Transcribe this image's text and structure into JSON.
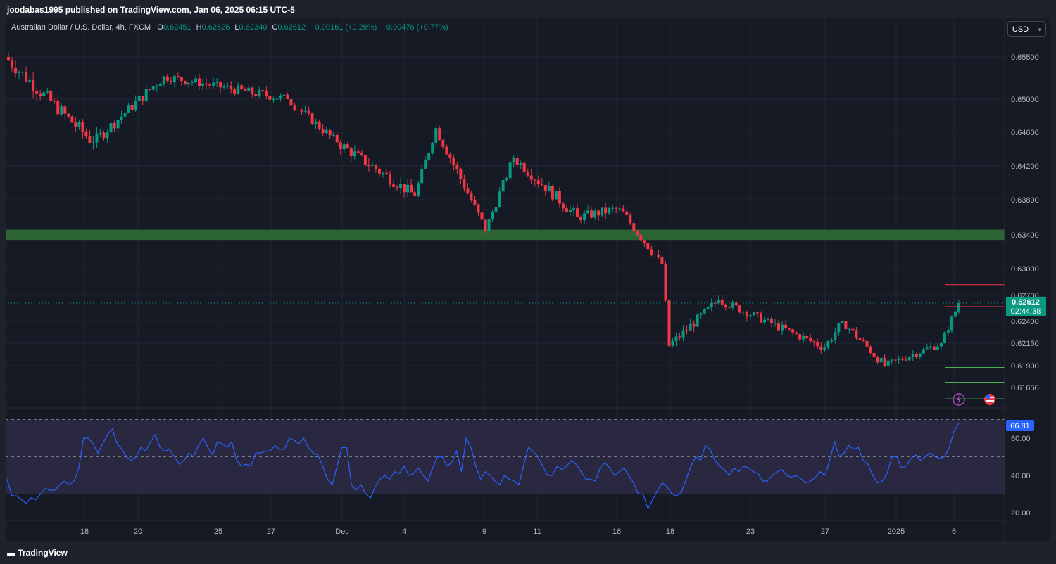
{
  "header": {
    "published_line": "joodabas1995 published on TradingView.com, Jan 06, 2025 06:15 UTC-5"
  },
  "legend": {
    "symbol": "Australian Dollar / U.S. Dollar, 4h, FXCM",
    "o_label": "O",
    "o_value": "0.62451",
    "h_label": "H",
    "h_value": "0.62626",
    "l_label": "L",
    "l_value": "0.62340",
    "c_label": "C",
    "c_value": "0.62612",
    "change": "+0.00161 (+0.26%)",
    "change2": "+0.00476 (+0.77%)"
  },
  "currency_button": "USD",
  "footer": {
    "brand": "TradingView"
  },
  "colors": {
    "up": "#089981",
    "down": "#f23645",
    "zone": "#2e6b34",
    "rsi_line": "#2962ff",
    "rsi_band": "#2a2740",
    "background": "#161a25"
  },
  "chart_data": [
    {
      "type": "candlestick",
      "price_ticks": [
        "0.65500",
        "0.65000",
        "0.64600",
        "0.64200",
        "0.63800",
        "0.63400",
        "0.63000",
        "0.62700",
        "0.62400",
        "0.62150",
        "0.61900",
        "0.61650"
      ],
      "x_ticks": [
        "18",
        "20",
        "25",
        "27",
        "Dec",
        "4",
        "9",
        "11",
        "16",
        "18",
        "23",
        "27",
        "2025",
        "6"
      ],
      "last_price": "0.62612",
      "countdown": "02:44:38",
      "support_zone": [
        0.6334,
        0.6346
      ],
      "levels_red": [
        0.6282,
        0.6257,
        0.6238
      ],
      "levels_green": [
        0.6188,
        0.6171,
        0.6152
      ],
      "segments": [
        {
          "bars": 25,
          "start": 0.655,
          "end": 0.6448,
          "amp": 0.0012
        },
        {
          "bars": 20,
          "start": 0.6448,
          "end": 0.6527,
          "amp": 0.001
        },
        {
          "bars": 35,
          "start": 0.6527,
          "end": 0.65,
          "amp": 0.0008
        },
        {
          "bars": 14,
          "start": 0.65,
          "end": 0.6448,
          "amp": 0.0008
        },
        {
          "bars": 22,
          "start": 0.6448,
          "end": 0.6385,
          "amp": 0.001
        },
        {
          "bars": 6,
          "start": 0.6385,
          "end": 0.6465,
          "amp": 0.0008
        },
        {
          "bars": 14,
          "start": 0.6465,
          "end": 0.6345,
          "amp": 0.001
        },
        {
          "bars": 8,
          "start": 0.6345,
          "end": 0.643,
          "amp": 0.0008
        },
        {
          "bars": 18,
          "start": 0.643,
          "end": 0.636,
          "amp": 0.001
        },
        {
          "bars": 12,
          "start": 0.636,
          "end": 0.637,
          "amp": 0.0008
        },
        {
          "bars": 12,
          "start": 0.637,
          "end": 0.6305,
          "amp": 0.0008
        },
        {
          "bars": 2,
          "start": 0.6305,
          "end": 0.6212,
          "amp": 0.001
        },
        {
          "bars": 14,
          "start": 0.6212,
          "end": 0.6265,
          "amp": 0.0008
        },
        {
          "bars": 30,
          "start": 0.6265,
          "end": 0.621,
          "amp": 0.0007
        },
        {
          "bars": 5,
          "start": 0.621,
          "end": 0.624,
          "amp": 0.0007
        },
        {
          "bars": 12,
          "start": 0.624,
          "end": 0.619,
          "amp": 0.0007
        },
        {
          "bars": 16,
          "start": 0.619,
          "end": 0.6215,
          "amp": 0.0006
        },
        {
          "bars": 5,
          "start": 0.6215,
          "end": 0.6261,
          "amp": 0.0006
        }
      ]
    },
    {
      "type": "line",
      "name": "RSI",
      "y_ticks": [
        "60.00",
        "40.00",
        "20.00"
      ],
      "levels": [
        70,
        50,
        30
      ],
      "last_value": "66.81",
      "values": [
        38,
        29,
        29,
        27,
        25,
        28,
        27,
        30,
        33,
        32,
        32,
        35,
        37,
        35,
        37,
        44,
        60,
        60,
        57,
        52,
        57,
        62,
        65,
        57,
        54,
        50,
        48,
        50,
        55,
        53,
        58,
        62,
        55,
        53,
        54,
        50,
        46,
        48,
        52,
        50,
        56,
        60,
        55,
        51,
        58,
        57,
        55,
        58,
        48,
        45,
        46,
        45,
        52,
        52,
        53,
        53,
        56,
        54,
        54,
        60,
        59,
        57,
        60,
        55,
        52,
        51,
        45,
        38,
        35,
        45,
        55,
        55,
        35,
        32,
        35,
        30,
        28,
        34,
        38,
        40,
        38,
        42,
        41,
        45,
        40,
        41,
        44,
        40,
        37,
        44,
        50,
        50,
        45,
        47,
        53,
        42,
        60,
        55,
        45,
        38,
        42,
        40,
        37,
        35,
        40,
        38,
        37,
        35,
        45,
        55,
        53,
        50,
        45,
        40,
        40,
        45,
        43,
        45,
        48,
        46,
        42,
        38,
        38,
        37,
        44,
        47,
        44,
        40,
        42,
        44,
        40,
        36,
        30,
        30,
        22,
        27,
        32,
        36,
        34,
        30,
        29,
        31,
        38,
        45,
        50,
        48,
        56,
        54,
        48,
        45,
        43,
        40,
        44,
        42,
        45,
        44,
        42,
        41,
        37,
        37,
        40,
        42,
        43,
        40,
        39,
        40,
        38,
        36,
        37,
        39,
        42,
        40,
        48,
        58,
        50,
        52,
        56,
        54,
        55,
        48,
        46,
        40,
        36,
        37,
        41,
        50,
        50,
        44,
        45,
        49,
        51,
        48,
        50,
        52,
        50,
        49,
        50,
        55,
        64,
        68
      ]
    }
  ]
}
